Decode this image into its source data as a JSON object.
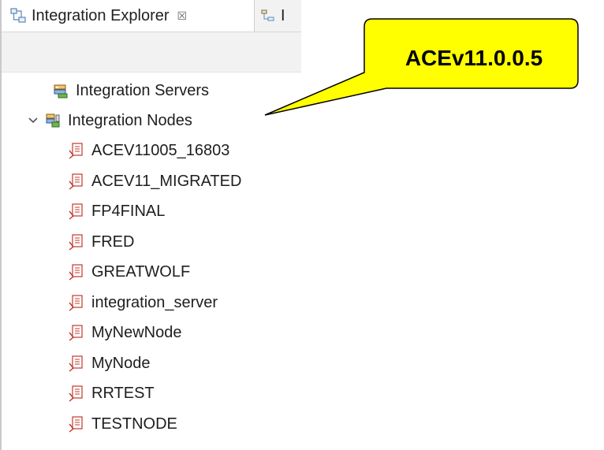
{
  "tabs": {
    "active": {
      "title": "Integration Explorer",
      "close": "☒"
    },
    "other_visible_text": "I"
  },
  "tree": {
    "servers": {
      "label": "Integration Servers"
    },
    "nodes": {
      "label": "Integration Nodes",
      "expanded": true,
      "items": [
        "ACEV11005_16803",
        "ACEV11_MIGRATED",
        "FP4FINAL",
        "FRED",
        "GREATWOLF",
        "integration_server",
        "MyNewNode",
        "MyNode",
        "RRTEST",
        "TESTNODE"
      ]
    }
  },
  "callout": {
    "text": "ACEv11.0.0.5",
    "fill": "#ffff00",
    "stroke": "#000000"
  }
}
